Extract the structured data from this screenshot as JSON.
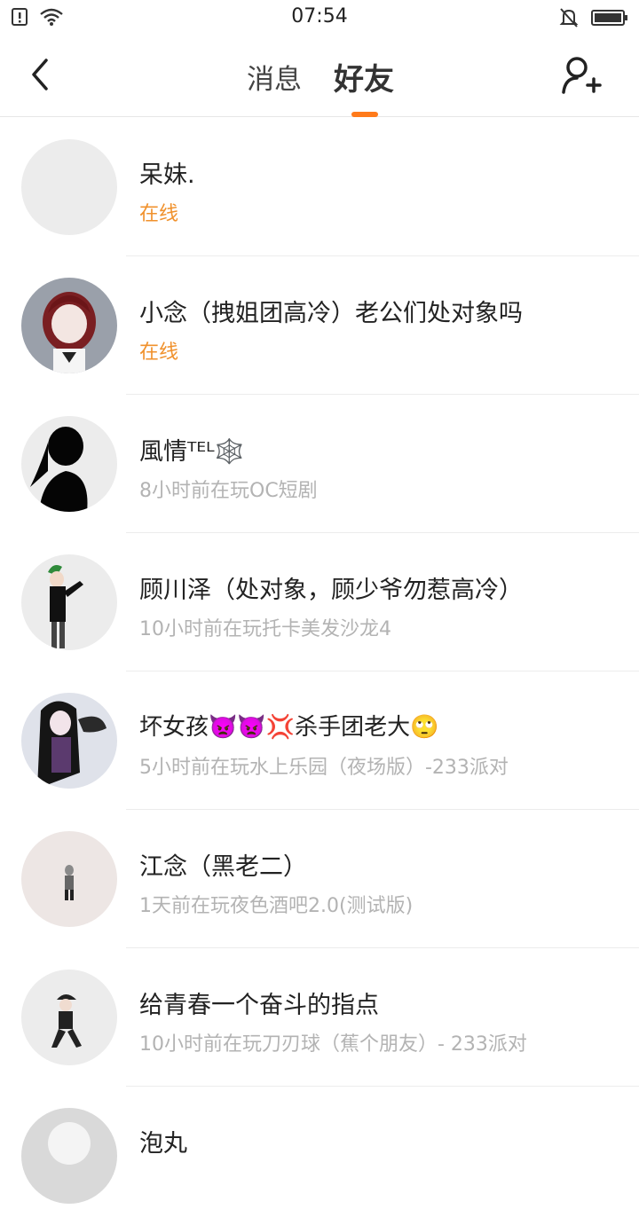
{
  "status_bar": {
    "time": "07:54",
    "icons": [
      "alert-icon",
      "wifi-icon",
      "mute-bell-icon",
      "battery-icon"
    ]
  },
  "nav": {
    "tabs": [
      {
        "label": "消息",
        "active": false
      },
      {
        "label": "好友",
        "active": true
      }
    ],
    "accent_color": "#ff7a1a"
  },
  "friends": [
    {
      "name": "呆妹.",
      "status": "在线",
      "online": true
    },
    {
      "name": "小念（拽姐团高冷）老公们处对象吗",
      "status": "在线",
      "online": true
    },
    {
      "name": "風情ᵀᴱᴸ🕸️",
      "status": "8小时前在玩OC短剧",
      "online": false
    },
    {
      "name": "顾川泽（处对象，顾少爷勿惹高冷）",
      "status": "10小时前在玩托卡美发沙龙4",
      "online": false
    },
    {
      "name": "坏女孩👿👿💢杀手团老大🙄",
      "status": "5小时前在玩水上乐园（夜场版）-233派对",
      "online": false
    },
    {
      "name": "江念（黑老二）",
      "status": "1天前在玩夜色酒吧2.0(测试版)",
      "online": false
    },
    {
      "name": "给青春一个奋斗的指点",
      "status": "10小时前在玩刀刃球（蕉个朋友）- 233派对",
      "online": false
    },
    {
      "name": "泡丸",
      "status": "",
      "online": false
    }
  ]
}
